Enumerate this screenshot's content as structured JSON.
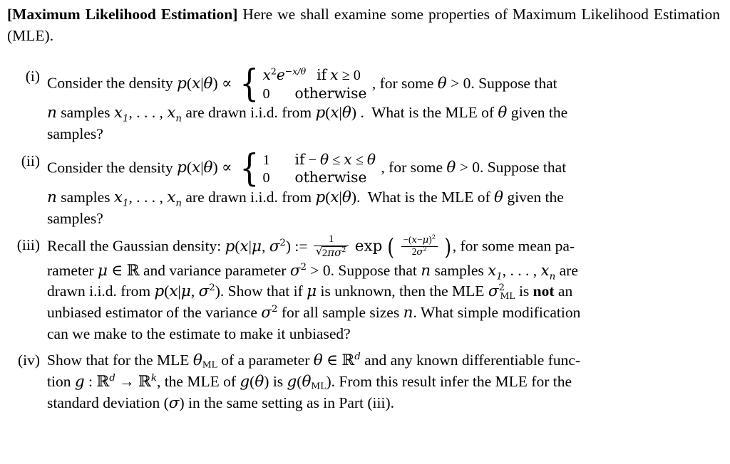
{
  "document": {
    "intro": {
      "bracket_title": "[Maximum Likelihood Estimation]",
      "text": " Here we shall examine some properties of Maximum Likelihood Estimation (MLE)."
    },
    "problems": [
      {
        "label": "(i)",
        "lead": "Consider the density",
        "density_lhs": "p(x|θ) ∝",
        "case_value_1": "x²e⁻ˣᐟθ",
        "case_cond_1": "if x ≥ 0",
        "case_value_2": "0",
        "case_cond_2": "otherwise",
        "after_cases": ", for some θ > 0. Suppose that",
        "line2_a": "n samples x₁, … , xₙ are drawn i.i.d. from p(x|θ) .  What is the MLE of θ given the",
        "line3": "samples?"
      },
      {
        "label": "(ii)",
        "lead": "Consider the density",
        "density_lhs": "p(x|θ) ∝",
        "case_value_1": "1",
        "case_cond_1": "if − θ ≤ x ≤ θ",
        "case_value_2": "0",
        "case_cond_2": "otherwise",
        "after_cases": ", for some θ > 0. Suppose that",
        "line2_a": "n samples x₁, … , xₙ are drawn i.i.d. from p(x|θ).  What is the MLE of θ given the",
        "line3": "samples?"
      },
      {
        "label": "(iii)",
        "line1_pre": "Recall the Gaussian density:",
        "formula_lhs": "p(x|μ, σ²) :=",
        "formula_frac_num": "1",
        "formula_frac_den": "√(2πσ²)",
        "formula_exp": "exp",
        "formula_exp_num": "−(x−μ)²",
        "formula_exp_den": "2σ²",
        "line1_post": ", for some mean pa-",
        "line2": "rameter μ ∈ ℝ and variance parameter σ² > 0. Suppose that n samples x₁, … , xₙ are",
        "line3": "drawn i.i.d. from p(x|μ, σ²). Show that if μ is unknown, then the MLE σ²ₘₗ is not an",
        "line3_bold_word": "not",
        "line4": "unbiased estimator of the variance σ² for all sample sizes n. What simple modification",
        "line5": "can we make to the estimate to make it unbiased?"
      },
      {
        "label": "(iv)",
        "line1": "Show that for the MLE θₘₗ of a parameter θ ∈ ℝᵈ and any known differentiable func-",
        "line2": "tion g : ℝᵈ → ℝᵏ, the MLE of g(θ) is g(θₘₗ). From this result infer the MLE for the",
        "line3": "standard deviation (σ) in the same setting as in Part (iii)."
      }
    ]
  }
}
